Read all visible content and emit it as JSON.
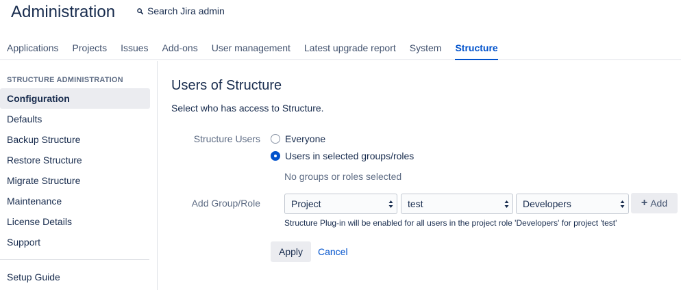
{
  "header": {
    "title": "Administration",
    "search_label": "Search Jira admin"
  },
  "tabs": [
    {
      "label": "Applications"
    },
    {
      "label": "Projects"
    },
    {
      "label": "Issues"
    },
    {
      "label": "Add-ons"
    },
    {
      "label": "User management"
    },
    {
      "label": "Latest upgrade report"
    },
    {
      "label": "System"
    },
    {
      "label": "Structure",
      "active": true
    }
  ],
  "sidebar": {
    "heading": "STRUCTURE ADMINISTRATION",
    "items": [
      {
        "label": "Configuration",
        "active": true
      },
      {
        "label": "Defaults"
      },
      {
        "label": "Backup Structure"
      },
      {
        "label": "Restore Structure"
      },
      {
        "label": "Migrate Structure"
      },
      {
        "label": "Maintenance"
      },
      {
        "label": "License Details"
      },
      {
        "label": "Support"
      }
    ],
    "bottom_items": [
      {
        "label": "Setup Guide"
      }
    ]
  },
  "main": {
    "title": "Users of Structure",
    "description": "Select who has access to Structure.",
    "structure_users_label": "Structure Users",
    "radio_options": [
      {
        "label": "Everyone",
        "checked": false
      },
      {
        "label": "Users in selected groups/roles",
        "checked": true
      }
    ],
    "no_selection_text": "No groups or roles selected",
    "add_group_label": "Add Group/Role",
    "selects": {
      "type": "Project",
      "project": "test",
      "role": "Developers"
    },
    "add_button": "Add",
    "hint": "Structure Plug-in will be enabled for all users in the project role 'Developers' for project 'test'",
    "apply_button": "Apply",
    "cancel_link": "Cancel"
  },
  "colors": {
    "accent": "#0052cc",
    "text": "#172b4d",
    "subtle": "#5e6c84",
    "button_bg": "#ebecf0",
    "border": "#dfe1e6"
  }
}
